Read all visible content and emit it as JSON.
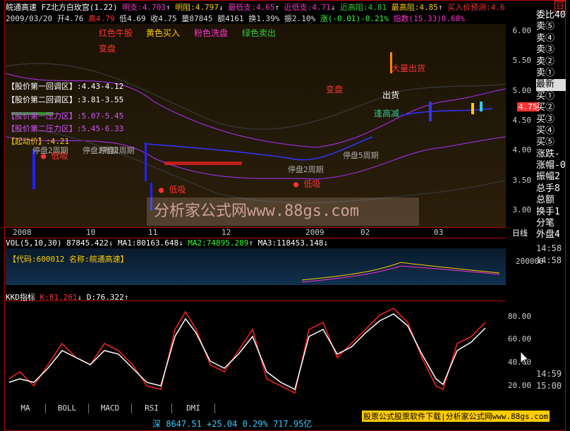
{
  "header": {
    "stock_name": "皖通高速",
    "indicator": "FZ北方白玫宫(1.22)",
    "mingzhi": "明支:4.703",
    "mingzu": "明阻:4.797",
    "zuidizhi": "最低支:4.65",
    "jindizhi": "近低支:4.71",
    "jingaozu": "近高阻:4.81",
    "zuigaozu": "最高阻:4.85",
    "mairuyuce": "买入价预测:4.6",
    "close_btn": "日",
    "date": "2009/03/20",
    "open": "开4.76",
    "high": "高4.79",
    "low": "低4.69",
    "close": "收4.75",
    "volume": "量87845",
    "amount": "额4161",
    "turnover": "换1.39%",
    "amplitude": "振2.10%",
    "change": "涨(-0.01)-0.21%",
    "index": "指数(15.33)0.68%"
  },
  "legend": {
    "red": "红色牛股",
    "yellow": "黄色买入",
    "pink": "粉色洗盘",
    "green": "绿色卖出",
    "biandian": "变盘"
  },
  "zones": {
    "z1": "【股价第一回调区】:4.43-4.12",
    "z2": "【股价第二回调区】:3.81-3.55",
    "z3": "【股价第一压力区】:5.07-5.45",
    "z4": "【股价第二压力区】:5.45-6.33",
    "qidong": "【起动价】:4.21"
  },
  "annotations": {
    "biandian2": "变盘",
    "dibi1": "低吸",
    "dibi2": "低吸",
    "dibi3": "低吸",
    "tingpan1": "停盘2周期",
    "tingpan2": "停盘2周期",
    "tingpan3": "停盘2周期",
    "tingpan4": "停盘5周期",
    "tingpan5": "停盘2周期",
    "dazhuchu": "大量出货",
    "chuhuo": "出货",
    "dazhu": "逢高减",
    "price_tag": "4.75"
  },
  "price_axis": [
    "6.00",
    "5.50",
    "5.00",
    "4.50",
    "4.00",
    "3.50",
    "3.00"
  ],
  "time_axis": [
    "2008",
    "10",
    "11",
    "12",
    "2009",
    "02",
    "03"
  ],
  "time_unit": "日线",
  "vol": {
    "title": "VOL(5,10,30)",
    "value": "87845.422",
    "ma1": "MA1:80163.648",
    "ma2": "MA2:74895.289",
    "ma3": "MA3:118453.148",
    "info": "【代码:600012 名称:皖通高速】",
    "axis": "200000"
  },
  "kdj": {
    "title": "KKD指标",
    "k": "K:81.261",
    "d": "D:76.322",
    "axis": [
      "80.00",
      "60.00",
      "40.00",
      "20.00"
    ]
  },
  "times": [
    "14:58",
    "14:58",
    "14:59",
    "15:00"
  ],
  "sidebar": [
    "委比40",
    "卖⑤",
    "卖④",
    "卖③",
    "卖②",
    "卖①",
    "最新",
    "买①",
    "买②",
    "买③",
    "买④",
    "买⑤",
    "涨跌-",
    "涨帽-0",
    "振幅2",
    "总手8",
    "总额",
    "换手1",
    "分笔",
    "外盘4"
  ],
  "bottom_tabs": [
    "MA",
    "BOLL",
    "MACD",
    "RSI",
    "DMI"
  ],
  "status": {
    "index": "深 8647.51 +25.04 0.29% 717.95亿",
    "ad": "股票公式股票软件下载|分析家公式网www.88gs.com"
  },
  "watermark": "分析家公式网www.88gs.com"
}
